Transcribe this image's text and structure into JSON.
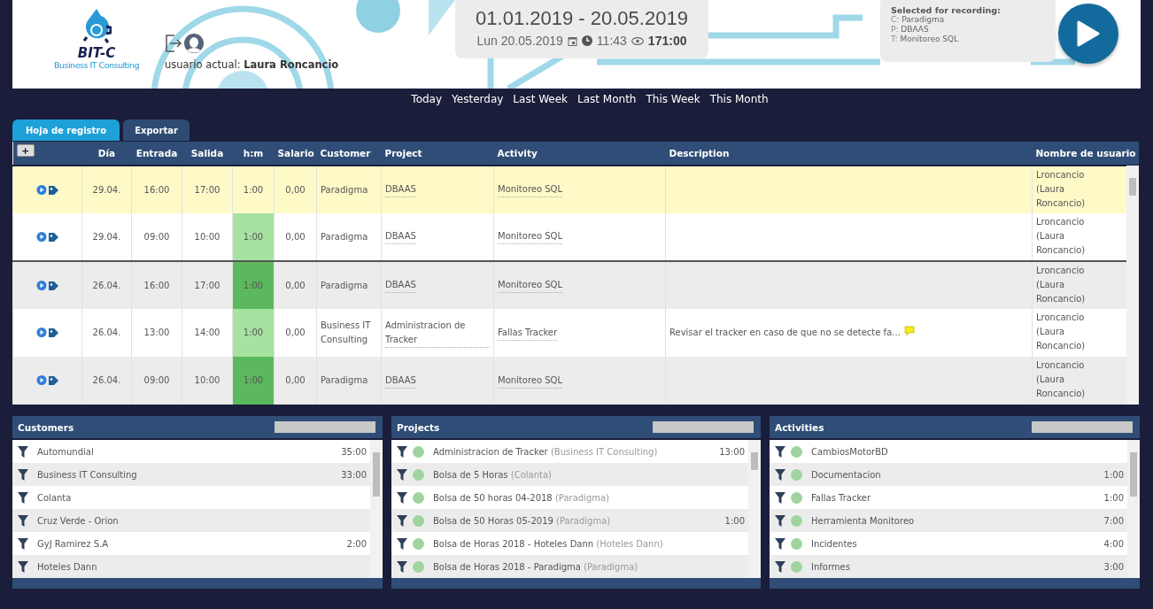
{
  "header": {
    "logo_text": "BIT-C",
    "logo_subtitle": "Business IT Consulting",
    "current_user": "usuario actual: **Laura Roncancio**",
    "date_range": "01.01.2019 - 20.05.2019",
    "today": "Lun 20.05.2019",
    "time": "11:43",
    "total": "171:00"
  },
  "recording": {
    "title": "Selected for recording:",
    "lines": [
      {
        "prefix": "C:",
        "value": "Paradigma"
      },
      {
        "prefix": "P:",
        "value": "DBAAS"
      },
      {
        "prefix": "T:",
        "value": "Monitoreo SQL"
      }
    ]
  },
  "quick_ranges": [
    "Today",
    "Yesterday",
    "Last Week",
    "Last Month",
    "This Week",
    "This Month"
  ],
  "tabs": [
    {
      "label": "Hoja de registro",
      "selected": true
    },
    {
      "label": "Exportar",
      "selected": false
    }
  ],
  "table": {
    "add_button": "+",
    "columns": [
      "Día",
      "Entrada",
      "Salida",
      "h:m",
      "Salario",
      "Customer",
      "Project",
      "Activity",
      "Description",
      "Nombre de usuario"
    ],
    "rows": [
      {
        "selected": true,
        "new_day": false,
        "day": "29.04.",
        "in": "16:00",
        "out": "17:00",
        "hm": "1:00",
        "salary": "0,00",
        "customer": "Paradigma",
        "project": "DBAAS",
        "activity": "Monitoreo SQL",
        "description": "",
        "has_comment": false,
        "user": "Lroncancio (Laura Roncancio)"
      },
      {
        "selected": false,
        "new_day": false,
        "color": "#a6e3a1",
        "day": "29.04.",
        "in": "09:00",
        "out": "10:00",
        "hm": "1:00",
        "salary": "0,00",
        "customer": "Paradigma",
        "project": "DBAAS",
        "activity": "Monitoreo SQL",
        "description": "",
        "has_comment": false,
        "user": "Lroncancio (Laura Roncancio)"
      },
      {
        "selected": false,
        "new_day": true,
        "color": "#5cb85c",
        "day": "26.04.",
        "in": "16:00",
        "out": "17:00",
        "hm": "1:00",
        "salary": "0,00",
        "customer": "Paradigma",
        "project": "DBAAS",
        "activity": "Monitoreo SQL",
        "description": "",
        "has_comment": false,
        "user": "Lroncancio (Laura Roncancio)"
      },
      {
        "selected": false,
        "new_day": false,
        "color": "#a6e3a1",
        "day": "26.04.",
        "in": "13:00",
        "out": "14:00",
        "hm": "1:00",
        "salary": "0,00",
        "customer": "Business IT Consulting",
        "project": "Administracion de Tracker",
        "activity": "Fallas Tracker",
        "description": "Revisar el tracker en caso de que no se detecte fa...",
        "has_comment": true,
        "user": "Lroncancio (Laura Roncancio)"
      },
      {
        "selected": false,
        "new_day": false,
        "color": "#5cb85c",
        "day": "26.04.",
        "in": "09:00",
        "out": "10:00",
        "hm": "1:00",
        "salary": "0,00",
        "customer": "Paradigma",
        "project": "DBAAS",
        "activity": "Monitoreo SQL",
        "description": "",
        "has_comment": false,
        "user": "Lroncancio (Laura Roncancio)"
      }
    ]
  },
  "panels": [
    {
      "kind": "customers",
      "title": "Customers",
      "items": [
        {
          "name": "Automundial",
          "time": "35:00"
        },
        {
          "name": "Business IT Consulting",
          "time": "33:00"
        },
        {
          "name": "Colanta"
        },
        {
          "name": "Cruz Verde - Orion"
        },
        {
          "name": "GyJ Ramirez S.A",
          "time": "2:00"
        },
        {
          "name": "Hoteles Dann"
        }
      ]
    },
    {
      "kind": "projects",
      "title": "Projects",
      "items": [
        {
          "name": "Administracion de Tracker",
          "owner": "(Business IT Consulting)",
          "time": "13:00"
        },
        {
          "name": "Bolsa de 5 Horas",
          "owner": "(Colanta)"
        },
        {
          "name": "Bolsa de 50 horas 04-2018",
          "owner": "(Paradigma)"
        },
        {
          "name": "Bolsa de 50 Horas 05-2019",
          "owner": "(Paradigma)",
          "time": "1:00"
        },
        {
          "name": "Bolsa de Horas 2018 - Hoteles Dann",
          "owner": "(Hoteles Dann)"
        },
        {
          "name": "Bolsa de Horas 2018 - Paradigma",
          "owner": "(Paradigma)"
        }
      ]
    },
    {
      "kind": "activities",
      "title": "Activities",
      "items": [
        {
          "name": "CambiosMotorBD"
        },
        {
          "name": "Documentacion",
          "time": "1:00"
        },
        {
          "name": "Fallas Tracker",
          "time": "1:00"
        },
        {
          "name": "Herramienta Monitoreo",
          "time": "7:00"
        },
        {
          "name": "Incidentes",
          "time": "4:00"
        },
        {
          "name": "Informes",
          "time": "3:00"
        }
      ]
    }
  ]
}
